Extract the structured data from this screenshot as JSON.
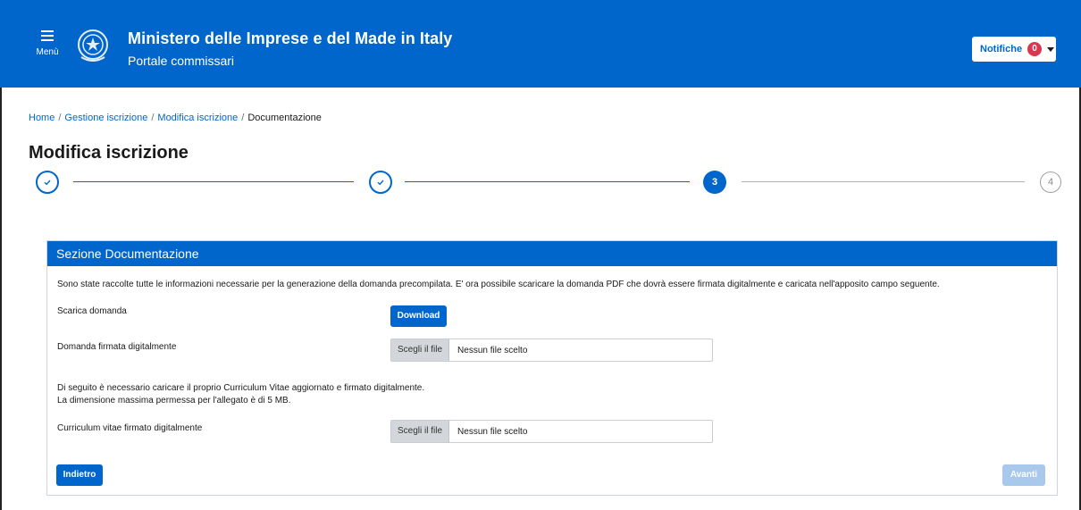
{
  "header": {
    "menu_label": "Menù",
    "title": "Ministero delle Imprese e del Made in Italy",
    "subtitle": "Portale commissari",
    "notifications_label": "Notifiche",
    "notifications_count": "0"
  },
  "breadcrumb": {
    "items": [
      "Home",
      "Gestione iscrizione",
      "Modifica iscrizione",
      "Documentazione"
    ]
  },
  "page_title": "Modifica iscrizione",
  "stepper": {
    "current_label": "3",
    "todo_label": "4"
  },
  "section": {
    "title": "Sezione Documentazione",
    "intro": "Sono state raccolte tutte le informazioni necessarie per la generazione della domanda precompilata. E' ora possibile scaricare la domanda PDF che dovrà essere firmata digitalmente e caricata nell'apposito campo seguente.",
    "download_label": "Scarica domanda",
    "download_button": "Download",
    "signed_label": "Domanda firmata digitalmente",
    "file_choose": "Scegli il file",
    "file_none": "Nessun file scelto",
    "cv_info_line1": "Di seguito è necessario caricare il proprio Curriculum Vitae aggiornato e firmato digitalmente.",
    "cv_info_line2": "La dimensione massima permessa per l'allegato è di 5 MB.",
    "cv_label": "Curriculum vitae firmato digitalmente",
    "back_button": "Indietro",
    "next_button": "Avanti"
  },
  "colors": {
    "primary": "#0066cc",
    "badge": "#d9364f",
    "disabled": "#a8c9ec"
  }
}
